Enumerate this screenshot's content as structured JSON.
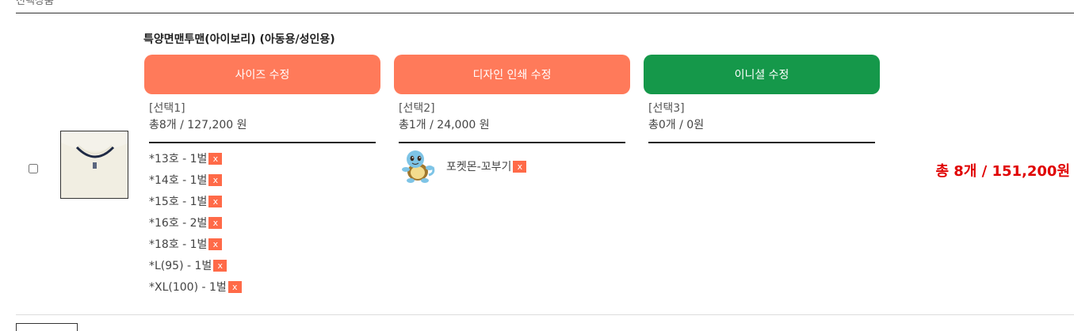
{
  "header_cut_text": "선택상품",
  "product": {
    "name": "특양면맨투맨(아이보리) (아동용/성인용)"
  },
  "buttons": {
    "size": "사이즈 수정",
    "design": "디자인 인쇄 수정",
    "initial": "이니셜 수정"
  },
  "colors": {
    "coral": "#ff7a5a",
    "green": "#15984a",
    "total_red": "#e00000"
  },
  "options": [
    {
      "label": "[선택1]",
      "summary": "총8개 / 127,200 원"
    },
    {
      "label": "[선택2]",
      "summary": "총1개 / 24,000 원"
    },
    {
      "label": "[선택3]",
      "summary": "총0개 / 0원"
    }
  ],
  "sizes": [
    "*13호 - 1벌",
    "*14호 - 1벌",
    "*15호 - 1벌",
    "*16호 - 2벌",
    "*18호 - 1벌",
    "*L(95) - 1벌",
    "*XL(100) - 1벌"
  ],
  "remove_label": "x",
  "design": {
    "name": "포켓몬-꼬부기",
    "icon": "squirtle-icon"
  },
  "total": "총 8개 / 151,200원"
}
